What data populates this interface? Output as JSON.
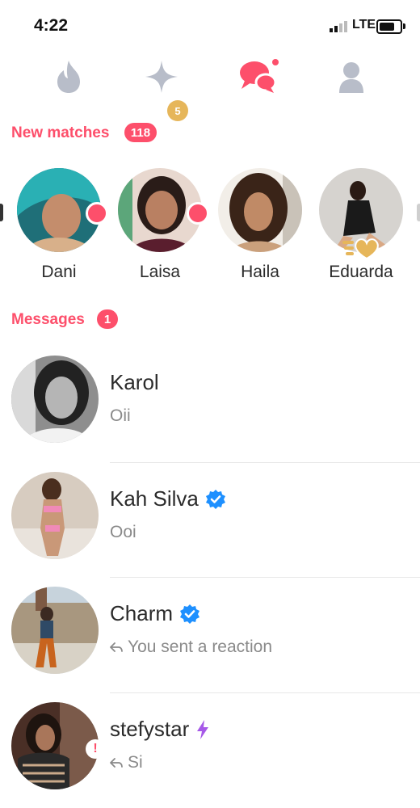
{
  "status": {
    "time": "4:22",
    "network": "LTE"
  },
  "nav": {
    "badge_count": "5",
    "tinder_color": "#b8bdc9",
    "active_color": "#fd4f6b",
    "gold": "#e6b65a"
  },
  "new_matches": {
    "label": "New matches",
    "count": "118",
    "items": [
      {
        "name": "Dani",
        "online": true
      },
      {
        "name": "Laisa",
        "online": true
      },
      {
        "name": "Haila",
        "online": false
      },
      {
        "name": "Eduarda",
        "online": false,
        "super_like": true
      }
    ]
  },
  "messages": {
    "label": "Messages",
    "count": "1",
    "items": [
      {
        "name": "Karol",
        "preview": "Oii",
        "verified": false
      },
      {
        "name": "Kah Silva",
        "preview": "Ooi",
        "verified": true
      },
      {
        "name": "Charm",
        "preview": "You sent a reaction",
        "verified": true,
        "reply_arrow": true
      },
      {
        "name": "stefystar",
        "preview": "Si",
        "verified": false,
        "bolt": true,
        "reply_arrow": true,
        "warning": "!"
      }
    ]
  },
  "colors": {
    "brand": "#fd4f6b",
    "verified": "#1e90ff",
    "bolt": "#a659e8"
  }
}
